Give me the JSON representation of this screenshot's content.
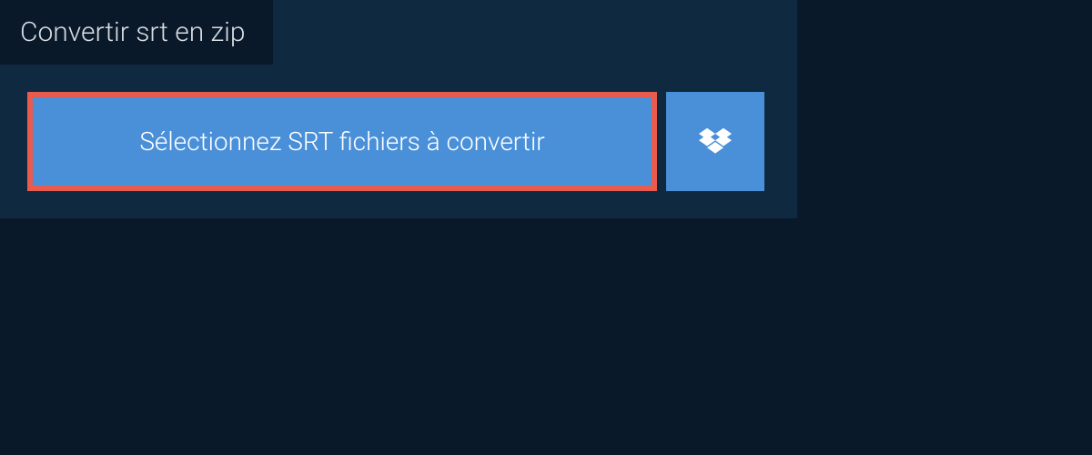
{
  "header": {
    "title": "Convertir srt en zip"
  },
  "main": {
    "select_button_label": "Sélectionnez SRT fichiers à convertir"
  }
}
